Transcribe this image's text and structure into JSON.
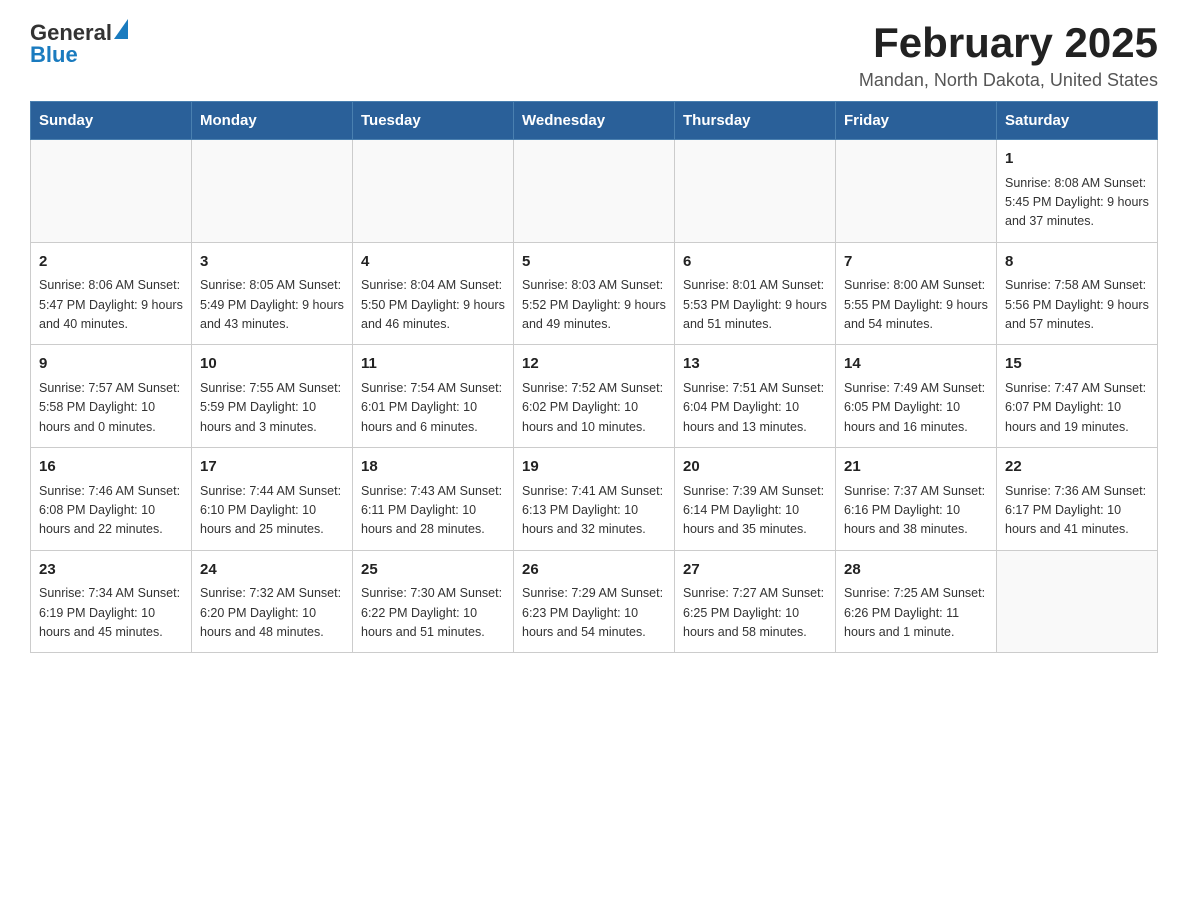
{
  "header": {
    "logo": {
      "text_general": "General",
      "text_blue": "Blue",
      "triangle_alt": "logo triangle"
    },
    "month_title": "February 2025",
    "location": "Mandan, North Dakota, United States"
  },
  "weekdays": [
    "Sunday",
    "Monday",
    "Tuesday",
    "Wednesday",
    "Thursday",
    "Friday",
    "Saturday"
  ],
  "weeks": [
    [
      {
        "day": "",
        "info": ""
      },
      {
        "day": "",
        "info": ""
      },
      {
        "day": "",
        "info": ""
      },
      {
        "day": "",
        "info": ""
      },
      {
        "day": "",
        "info": ""
      },
      {
        "day": "",
        "info": ""
      },
      {
        "day": "1",
        "info": "Sunrise: 8:08 AM\nSunset: 5:45 PM\nDaylight: 9 hours and 37 minutes."
      }
    ],
    [
      {
        "day": "2",
        "info": "Sunrise: 8:06 AM\nSunset: 5:47 PM\nDaylight: 9 hours and 40 minutes."
      },
      {
        "day": "3",
        "info": "Sunrise: 8:05 AM\nSunset: 5:49 PM\nDaylight: 9 hours and 43 minutes."
      },
      {
        "day": "4",
        "info": "Sunrise: 8:04 AM\nSunset: 5:50 PM\nDaylight: 9 hours and 46 minutes."
      },
      {
        "day": "5",
        "info": "Sunrise: 8:03 AM\nSunset: 5:52 PM\nDaylight: 9 hours and 49 minutes."
      },
      {
        "day": "6",
        "info": "Sunrise: 8:01 AM\nSunset: 5:53 PM\nDaylight: 9 hours and 51 minutes."
      },
      {
        "day": "7",
        "info": "Sunrise: 8:00 AM\nSunset: 5:55 PM\nDaylight: 9 hours and 54 minutes."
      },
      {
        "day": "8",
        "info": "Sunrise: 7:58 AM\nSunset: 5:56 PM\nDaylight: 9 hours and 57 minutes."
      }
    ],
    [
      {
        "day": "9",
        "info": "Sunrise: 7:57 AM\nSunset: 5:58 PM\nDaylight: 10 hours and 0 minutes."
      },
      {
        "day": "10",
        "info": "Sunrise: 7:55 AM\nSunset: 5:59 PM\nDaylight: 10 hours and 3 minutes."
      },
      {
        "day": "11",
        "info": "Sunrise: 7:54 AM\nSunset: 6:01 PM\nDaylight: 10 hours and 6 minutes."
      },
      {
        "day": "12",
        "info": "Sunrise: 7:52 AM\nSunset: 6:02 PM\nDaylight: 10 hours and 10 minutes."
      },
      {
        "day": "13",
        "info": "Sunrise: 7:51 AM\nSunset: 6:04 PM\nDaylight: 10 hours and 13 minutes."
      },
      {
        "day": "14",
        "info": "Sunrise: 7:49 AM\nSunset: 6:05 PM\nDaylight: 10 hours and 16 minutes."
      },
      {
        "day": "15",
        "info": "Sunrise: 7:47 AM\nSunset: 6:07 PM\nDaylight: 10 hours and 19 minutes."
      }
    ],
    [
      {
        "day": "16",
        "info": "Sunrise: 7:46 AM\nSunset: 6:08 PM\nDaylight: 10 hours and 22 minutes."
      },
      {
        "day": "17",
        "info": "Sunrise: 7:44 AM\nSunset: 6:10 PM\nDaylight: 10 hours and 25 minutes."
      },
      {
        "day": "18",
        "info": "Sunrise: 7:43 AM\nSunset: 6:11 PM\nDaylight: 10 hours and 28 minutes."
      },
      {
        "day": "19",
        "info": "Sunrise: 7:41 AM\nSunset: 6:13 PM\nDaylight: 10 hours and 32 minutes."
      },
      {
        "day": "20",
        "info": "Sunrise: 7:39 AM\nSunset: 6:14 PM\nDaylight: 10 hours and 35 minutes."
      },
      {
        "day": "21",
        "info": "Sunrise: 7:37 AM\nSunset: 6:16 PM\nDaylight: 10 hours and 38 minutes."
      },
      {
        "day": "22",
        "info": "Sunrise: 7:36 AM\nSunset: 6:17 PM\nDaylight: 10 hours and 41 minutes."
      }
    ],
    [
      {
        "day": "23",
        "info": "Sunrise: 7:34 AM\nSunset: 6:19 PM\nDaylight: 10 hours and 45 minutes."
      },
      {
        "day": "24",
        "info": "Sunrise: 7:32 AM\nSunset: 6:20 PM\nDaylight: 10 hours and 48 minutes."
      },
      {
        "day": "25",
        "info": "Sunrise: 7:30 AM\nSunset: 6:22 PM\nDaylight: 10 hours and 51 minutes."
      },
      {
        "day": "26",
        "info": "Sunrise: 7:29 AM\nSunset: 6:23 PM\nDaylight: 10 hours and 54 minutes."
      },
      {
        "day": "27",
        "info": "Sunrise: 7:27 AM\nSunset: 6:25 PM\nDaylight: 10 hours and 58 minutes."
      },
      {
        "day": "28",
        "info": "Sunrise: 7:25 AM\nSunset: 6:26 PM\nDaylight: 11 hours and 1 minute."
      },
      {
        "day": "",
        "info": ""
      }
    ]
  ]
}
